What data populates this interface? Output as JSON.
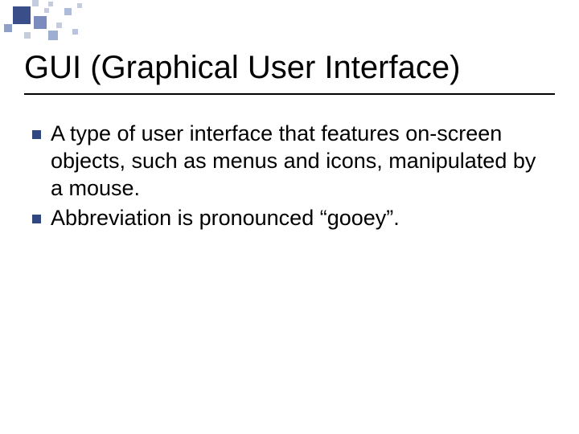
{
  "slide": {
    "title": "GUI (Graphical User Interface)",
    "bullets": [
      "A type of user interface that features on-screen objects, such as menus and icons, manipulated by a mouse.",
      "Abbreviation is pronounced “gooey”."
    ]
  }
}
